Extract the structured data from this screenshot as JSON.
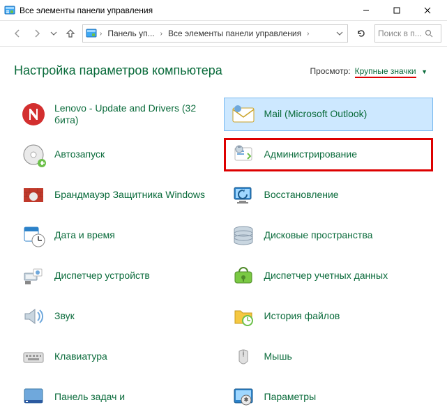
{
  "window": {
    "title": "Все элементы панели управления"
  },
  "breadcrumbs": {
    "item0": "Панель уп...",
    "item1": "Все элементы панели управления"
  },
  "search": {
    "placeholder": "Поиск в п..."
  },
  "header": {
    "heading": "Настройка параметров компьютера",
    "view_label": "Просмотр:",
    "view_value": "Крупные значки"
  },
  "items": {
    "r0c0": "Lenovo - Update and Drivers (32 бита)",
    "r0c1": "Mail (Microsoft Outlook)",
    "r1c0": "Автозапуск",
    "r1c1": "Администрирование",
    "r2c0": "Брандмауэр Защитника Windows",
    "r2c1": "Восстановление",
    "r3c0": "Дата и время",
    "r3c1": "Дисковые пространства",
    "r4c0": "Диспетчер устройств",
    "r4c1": "Диспетчер учетных данных",
    "r5c0": "Звук",
    "r5c1": "История файлов",
    "r6c0": "Клавиатура",
    "r6c1": "Мышь",
    "r7c0": "Панель задач и",
    "r7c1": "Параметры"
  }
}
